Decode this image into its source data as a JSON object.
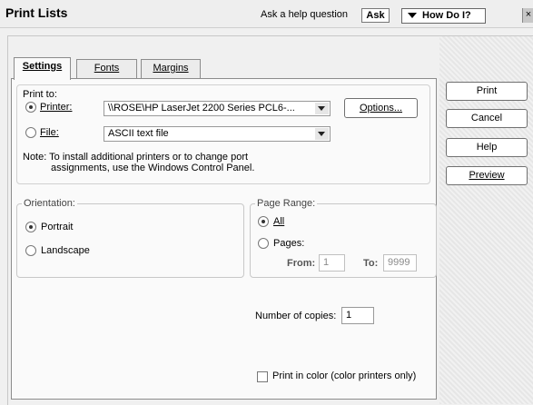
{
  "window": {
    "title": "Print Lists",
    "help_question": "Ask a help question",
    "ask_label": "Ask",
    "how_do_i_label": "How Do I?",
    "close_glyph": "×"
  },
  "tabs": [
    {
      "label": "Settings",
      "active": true
    },
    {
      "label": "Fonts",
      "active": false
    },
    {
      "label": "Margins",
      "active": false
    }
  ],
  "print_to": {
    "label": "Print to:",
    "printer_label": "Printer:",
    "printer_value": "\\\\ROSE\\HP LaserJet 2200 Series PCL6-...",
    "printer_selected": true,
    "options_label": "Options...",
    "file_label": "File:",
    "file_value": "ASCII text file",
    "file_selected": false,
    "note_line1": "Note: To install additional printers or to change port",
    "note_line2": "assignments, use the Windows Control Panel."
  },
  "orientation": {
    "legend": "Orientation:",
    "portrait_label": "Portrait",
    "landscape_label": "Landscape",
    "selected": "Portrait"
  },
  "page_range": {
    "legend": "Page Range:",
    "all_label": "All",
    "pages_label": "Pages:",
    "selected": "All",
    "from_label": "From:",
    "from_value": "1",
    "to_label": "To:",
    "to_value": "9999"
  },
  "copies": {
    "label": "Number of copies:",
    "value": "1"
  },
  "color_print": {
    "label": "Print in color (color printers only)",
    "checked": false
  },
  "side_buttons": {
    "print": "Print",
    "cancel": "Cancel",
    "help": "Help",
    "preview": "Preview"
  },
  "icons": {
    "dropdown": "chevron-down-icon",
    "radio": "radio-icon",
    "checkbox": "checkbox-icon"
  }
}
